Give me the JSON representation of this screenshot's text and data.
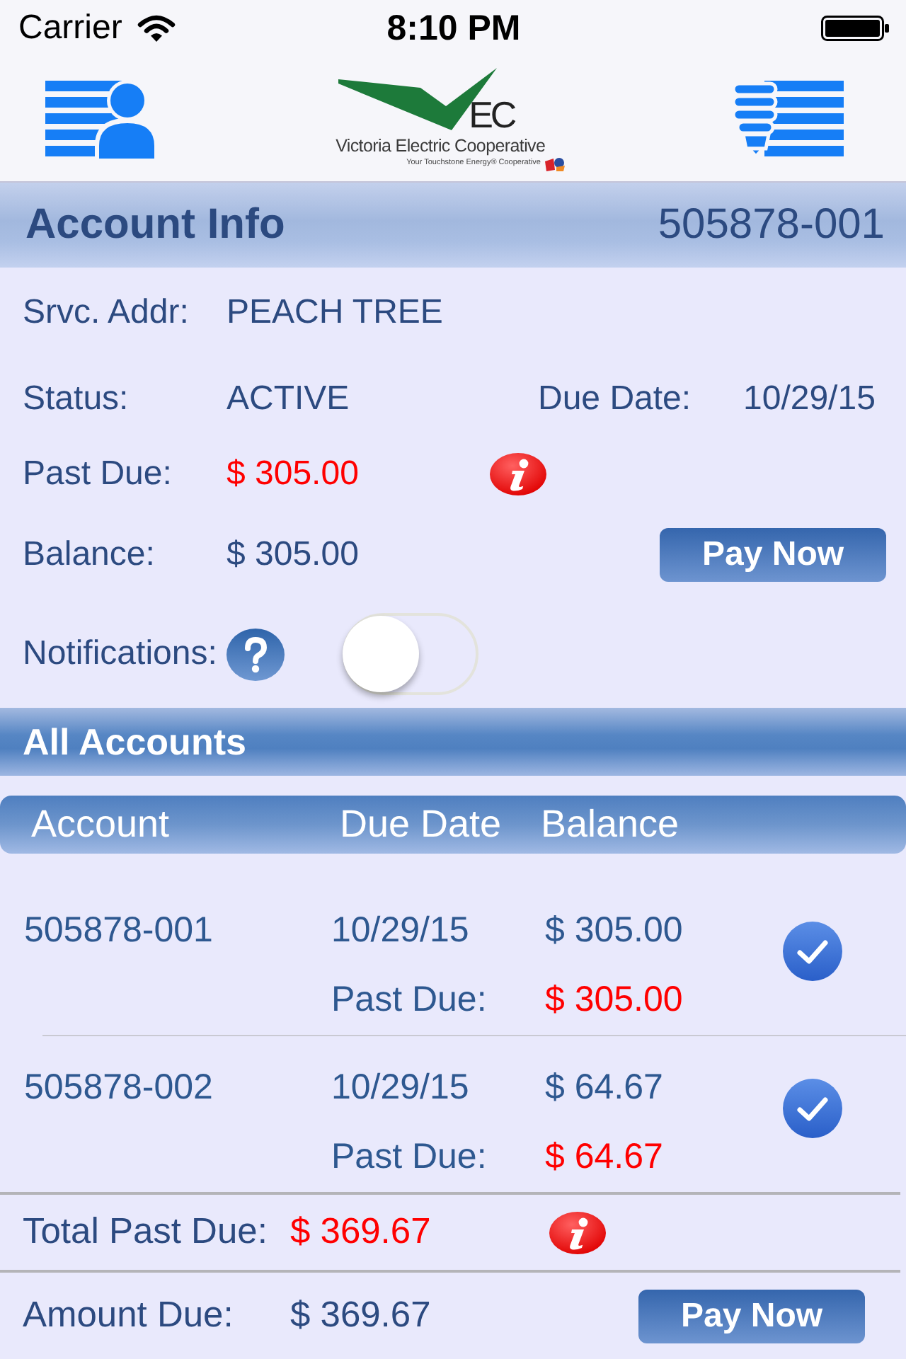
{
  "status_bar": {
    "carrier": "Carrier",
    "time": "8:10 PM"
  },
  "nav_bar": {
    "logo": {
      "mark": "EC",
      "name": "Victoria Electric Cooperative",
      "tagline": "Your Touchstone Energy® Cooperative"
    }
  },
  "account_info": {
    "title": "Account Info",
    "account_number": "505878-001",
    "service_address": {
      "label": "Srvc. Addr:",
      "value": "PEACH TREE"
    },
    "status": {
      "label": "Status:",
      "value": "ACTIVE"
    },
    "due_date": {
      "label": "Due Date:",
      "value": "10/29/15"
    },
    "past_due": {
      "label": "Past Due:",
      "value": "$ 305.00"
    },
    "balance": {
      "label": "Balance:",
      "value": "$ 305.00"
    },
    "pay_button": "Pay Now",
    "notifications": {
      "label": "Notifications:",
      "on": false
    }
  },
  "all_accounts": {
    "title": "All Accounts",
    "columns": [
      "Account",
      "Due Date",
      "Balance"
    ],
    "rows": [
      {
        "account": "505878-001",
        "due_date": "10/29/15",
        "balance": "$ 305.00",
        "past_due_label": "Past Due:",
        "past_due": "$ 305.00",
        "checked": true
      },
      {
        "account": "505878-002",
        "due_date": "10/29/15",
        "balance": "$ 64.67",
        "past_due_label": "Past Due:",
        "past_due": "$ 64.67",
        "checked": true
      }
    ],
    "total_past_due": {
      "label": "Total Past Due:",
      "value": "$ 369.67"
    },
    "amount_due": {
      "label": "Amount Due:",
      "value": "$ 369.67"
    },
    "pay_button": "Pay Now"
  }
}
